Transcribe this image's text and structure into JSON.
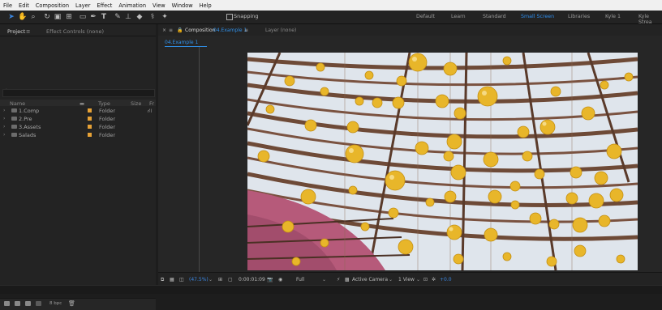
{
  "menu": [
    "File",
    "Edit",
    "Composition",
    "Layer",
    "Effect",
    "Animation",
    "View",
    "Window",
    "Help"
  ],
  "toolbar": {
    "snapping_label": "Snapping",
    "workspaces": [
      {
        "label": "Default",
        "active": false
      },
      {
        "label": "Learn",
        "active": false
      },
      {
        "label": "Standard",
        "active": false
      },
      {
        "label": "Small Screen",
        "active": true
      },
      {
        "label": "Libraries",
        "active": false
      },
      {
        "label": "Kyle 1",
        "active": false
      },
      {
        "label": "Kyle Strea",
        "active": false
      }
    ]
  },
  "project_panel": {
    "tab_label": "Project",
    "effect_controls_label": "Effect Controls (none)",
    "columns": {
      "name": "Name",
      "type": "Type",
      "size": "Size",
      "fr": "Fr"
    },
    "items": [
      {
        "name": "1.Comp",
        "type": "Folder"
      },
      {
        "name": "2.Pre",
        "type": "Folder"
      },
      {
        "name": "3.Assets",
        "type": "Folder"
      },
      {
        "name": "Salads",
        "type": "Folder"
      }
    ],
    "bpc_label": "8 bpc"
  },
  "composition_panel": {
    "comp_label": "Composition",
    "comp_name": "04.Example 1",
    "layer_label": "Layer (none)",
    "viewer_tab": "04.Example 1"
  },
  "viewer_footer": {
    "zoom": "(47.5%)",
    "timecode": "0:00:01:09",
    "resolution": "Full",
    "camera": "Active Camera",
    "views": "1 View",
    "exposure": "+0.0"
  },
  "colors": {
    "accent": "#2d8ceb",
    "folder_label": "#e7a236"
  }
}
